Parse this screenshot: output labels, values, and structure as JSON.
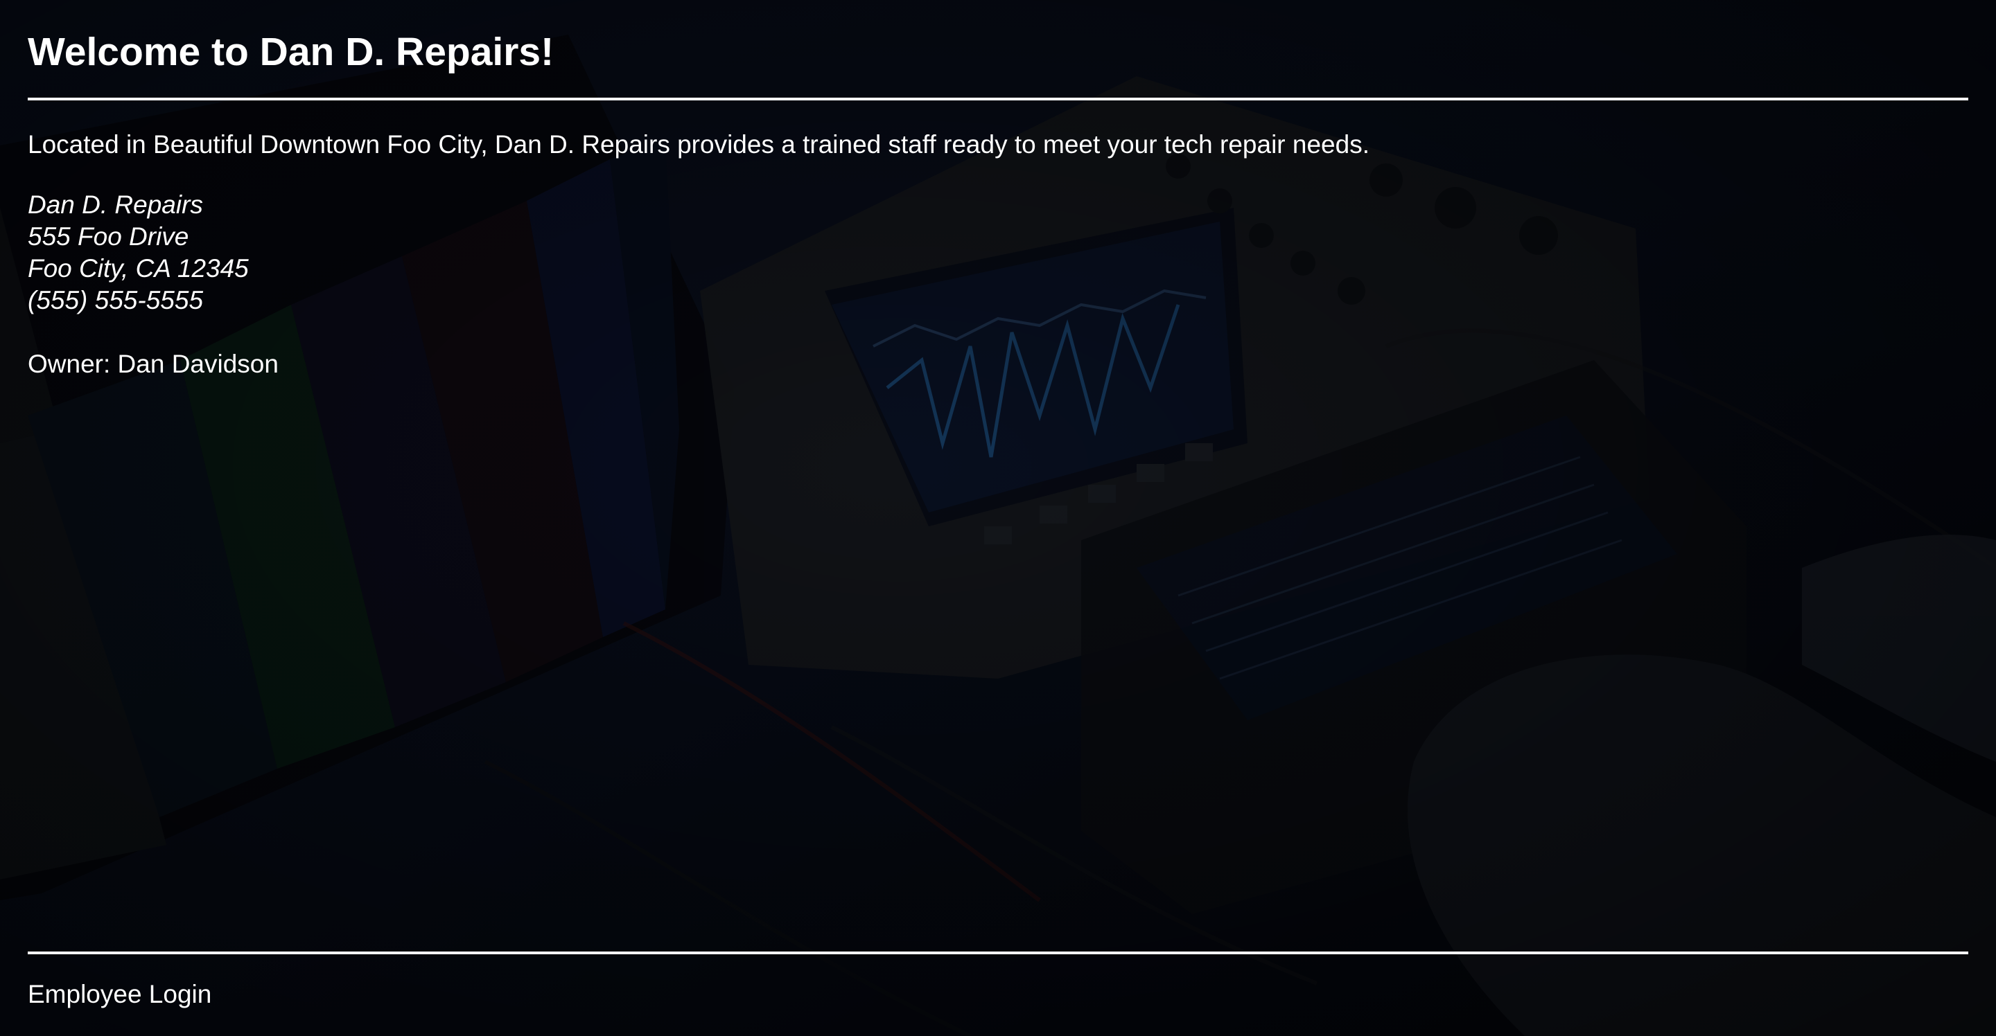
{
  "header": {
    "title": "Welcome to Dan D. Repairs!"
  },
  "main": {
    "intro": "Located in Beautiful Downtown Foo City, Dan D. Repairs provides a trained staff ready to meet your tech repair needs.",
    "address": {
      "name": "Dan D. Repairs",
      "street": "555 Foo Drive",
      "city_line": "Foo City, CA 12345",
      "phone": "(555) 555-5555"
    },
    "owner": "Owner: Dan Davidson"
  },
  "footer": {
    "login_label": "Employee Login"
  },
  "colors": {
    "text": "#ffffff",
    "background": "#04060d",
    "overlay_tint": "#0b1530"
  }
}
